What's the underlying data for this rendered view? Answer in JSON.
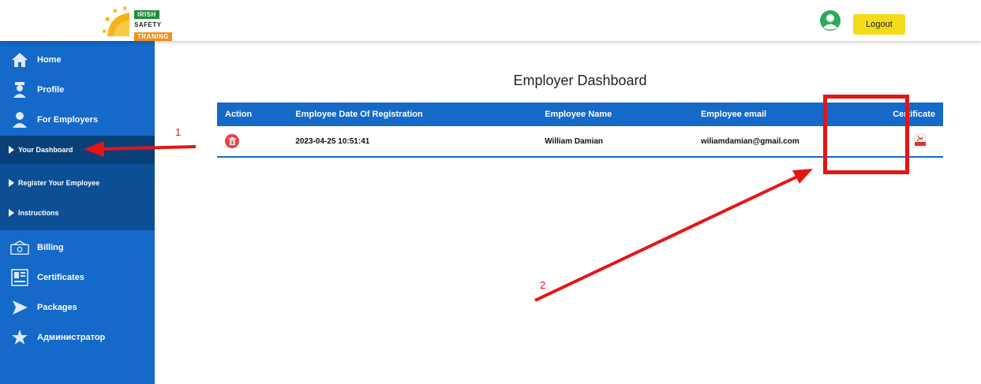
{
  "header": {
    "logo": {
      "line1": "IRISH",
      "line2": "SAFETY",
      "line3": "TRANING"
    },
    "logout_label": "Logout"
  },
  "sidebar": {
    "items": [
      {
        "label": "Home",
        "icon": "home-icon"
      },
      {
        "label": "Profile",
        "icon": "profile-icon"
      },
      {
        "label": "For Employers",
        "icon": "user-icon"
      },
      {
        "label": "Billing",
        "icon": "billing-icon"
      },
      {
        "label": "Certificates",
        "icon": "certificates-icon"
      },
      {
        "label": "Packages",
        "icon": "packages-icon"
      },
      {
        "label": "Администратор",
        "icon": "star-icon"
      }
    ],
    "submenu": [
      {
        "label": "Your Dashboard",
        "active": true
      },
      {
        "label": "Register Your Employee"
      },
      {
        "label": "Instructions"
      }
    ]
  },
  "main": {
    "title": "Employer Dashboard",
    "table": {
      "columns": [
        "Action",
        "Employee Date Of Registration",
        "Employee Name",
        "Employee email",
        "Certificate"
      ],
      "rows": [
        {
          "date": "2023-04-25 10:51:41",
          "name": "William Damian",
          "email": "wiliamdamian@gmail.com"
        }
      ]
    }
  },
  "annotations": {
    "label1": "1",
    "label2": "2"
  },
  "colors": {
    "sidebar": "#1469c9",
    "submenu": "#0d4f94",
    "logout": "#f2dc1a",
    "annotation": "#e51515",
    "delete": "#e8414b"
  }
}
